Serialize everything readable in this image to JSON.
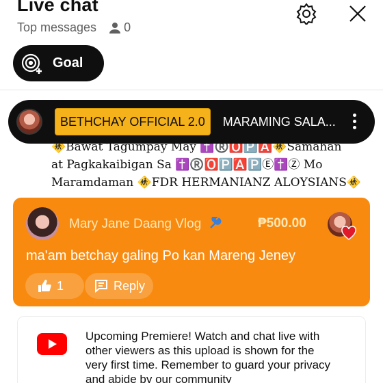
{
  "header": {
    "title": "Live chat",
    "subtitle": "Top messages",
    "viewer_count": "0",
    "goal_label": "Goal"
  },
  "pinned": {
    "badge": "BETHCHAY OFFICIAL 2.0",
    "message": "MARAMING SALA..."
  },
  "chat_message": {
    "line1": "🚸Bawat Tagumpay May ✝️®️🅾️🅿️🅰️🚸Samahan",
    "line2": "at Pagkakaibigan Sa ✝️®️🅾️🅿️🅰️🅿️Ⓔ✝️Ⓩ Mo",
    "line3": "Maramdaman 🚸FDR HERMANIANZ ALOYSIANS🚸"
  },
  "superchat": {
    "author": "Mary Jane Daang Vlog",
    "amount": "₱500.00",
    "message": "ma'am betchay galing Po kan Mareng Jeney",
    "like_count": "1",
    "reply_label": "Reply",
    "color": "#f88a10"
  },
  "notice": {
    "text": "Upcoming Premiere! Watch and chat live with other viewers as this upload is shown for the very first time. Remember to guard your privacy and abide by our community"
  },
  "icons": [
    "settings-gear-icon",
    "close-icon",
    "goal-target-icon",
    "person-icon",
    "more-vert-icon",
    "wrench-icon",
    "heart-icon",
    "thumbs-up-icon",
    "reply-icon",
    "youtube-icon"
  ]
}
